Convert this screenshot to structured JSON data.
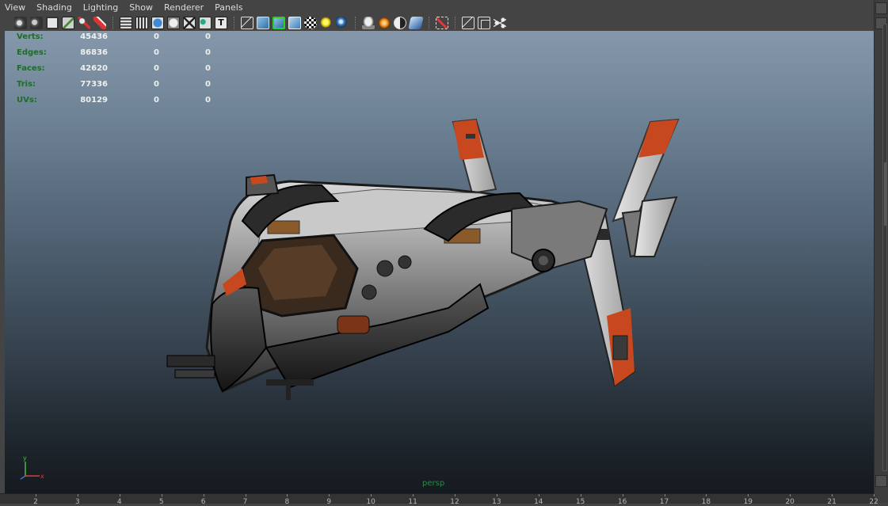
{
  "menubar": {
    "items": [
      "View",
      "Shading",
      "Lighting",
      "Show",
      "Renderer",
      "Panels"
    ]
  },
  "toolbar": {
    "groups": [
      [
        "camera-attributes-icon",
        "camera-lock-icon",
        "bookmark-icon",
        "image-plane-icon",
        "2d-pan-zoom-icon",
        "grease-pencil-icon"
      ],
      [
        "grid-icon",
        "film-gate-icon",
        "resolution-gate-icon",
        "gate-mask-icon",
        "field-chart-icon",
        "safe-action-icon",
        "safe-title-icon"
      ],
      [
        "wireframe-icon",
        "smooth-shade-icon",
        "use-default-material-icon",
        "wireframe-on-shaded-icon",
        "xray-icon",
        "textured-icon",
        "all-lights-icon",
        "default-light-icon"
      ],
      [
        "shadows-icon",
        "screen-space-ao-icon",
        "motion-blur-icon",
        "anti-aliasing-icon",
        "depth-of-field-icon"
      ],
      [
        "isolate-select-icon",
        "xray-joints-icon",
        "xray-active-components-icon",
        "share-icon"
      ]
    ]
  },
  "hud": {
    "rows": [
      {
        "label": "Verts:",
        "v1": "45436",
        "v2": "0",
        "v3": "0"
      },
      {
        "label": "Edges:",
        "v1": "86836",
        "v2": "0",
        "v3": "0"
      },
      {
        "label": "Faces:",
        "v1": "42620",
        "v2": "0",
        "v3": "0"
      },
      {
        "label": "Tris:",
        "v1": "77336",
        "v2": "0",
        "v3": "0"
      },
      {
        "label": "UVs:",
        "v1": "80129",
        "v2": "0",
        "v3": "0"
      }
    ]
  },
  "viewport": {
    "camera_label": "persp",
    "axis": {
      "y": "y",
      "x": "x"
    }
  },
  "timeline": {
    "ticks": [
      "2",
      "3",
      "4",
      "5",
      "6",
      "7",
      "8",
      "9",
      "10",
      "11",
      "12",
      "13",
      "14",
      "15",
      "16",
      "17",
      "18",
      "19",
      "20",
      "21",
      "22"
    ]
  },
  "colors": {
    "hud_label": "#1f6b2a",
    "hud_value": "#eef0ee",
    "camera_label": "#2f8a49",
    "accent_orange": "#c7481f"
  }
}
